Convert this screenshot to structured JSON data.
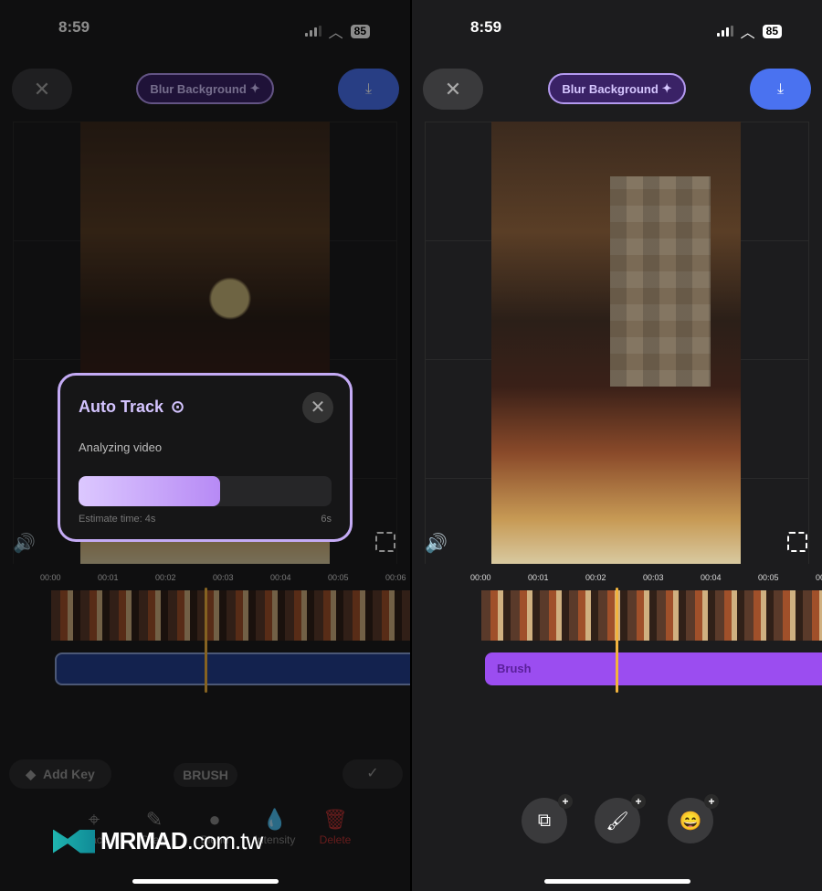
{
  "status": {
    "time": "8:59",
    "battery": "85"
  },
  "header": {
    "close_icon": "close-icon",
    "title": "Blur Background",
    "download_icon": "download-icon"
  },
  "colors": {
    "accent_purple": "#9b4df0",
    "download_blue": "#4a72f0",
    "playhead": "#f2b33d",
    "track_blue": "#233f8f"
  },
  "timeline": {
    "ticks": [
      "00:00",
      "00:01",
      "00:02",
      "00:03",
      "00:04",
      "00:05",
      "00:06"
    ]
  },
  "left": {
    "modal": {
      "title": "Auto Track",
      "subtitle": "Analyzing video",
      "progress_percent": 56,
      "estimate": "Estimate time: 4s",
      "total": "6s"
    },
    "toolbar": {
      "add_key": "Add Key",
      "mode": "BRUSH"
    },
    "tools": [
      {
        "label": "Track",
        "icon": "crosshair-icon"
      },
      {
        "label": "Draw",
        "icon": "pencil-icon"
      },
      {
        "label": "Blend",
        "icon": "circles-icon"
      },
      {
        "label": "Intensity",
        "icon": "drop-icon"
      },
      {
        "label": "Delete",
        "icon": "trash-icon"
      }
    ]
  },
  "right": {
    "track_label": "Brush",
    "add_buttons": [
      {
        "icon": "shape-icon"
      },
      {
        "icon": "brush-icon"
      },
      {
        "icon": "emoji-icon"
      }
    ]
  },
  "watermark": {
    "text": "MRMAD",
    ".suffix": ".com.tw"
  }
}
